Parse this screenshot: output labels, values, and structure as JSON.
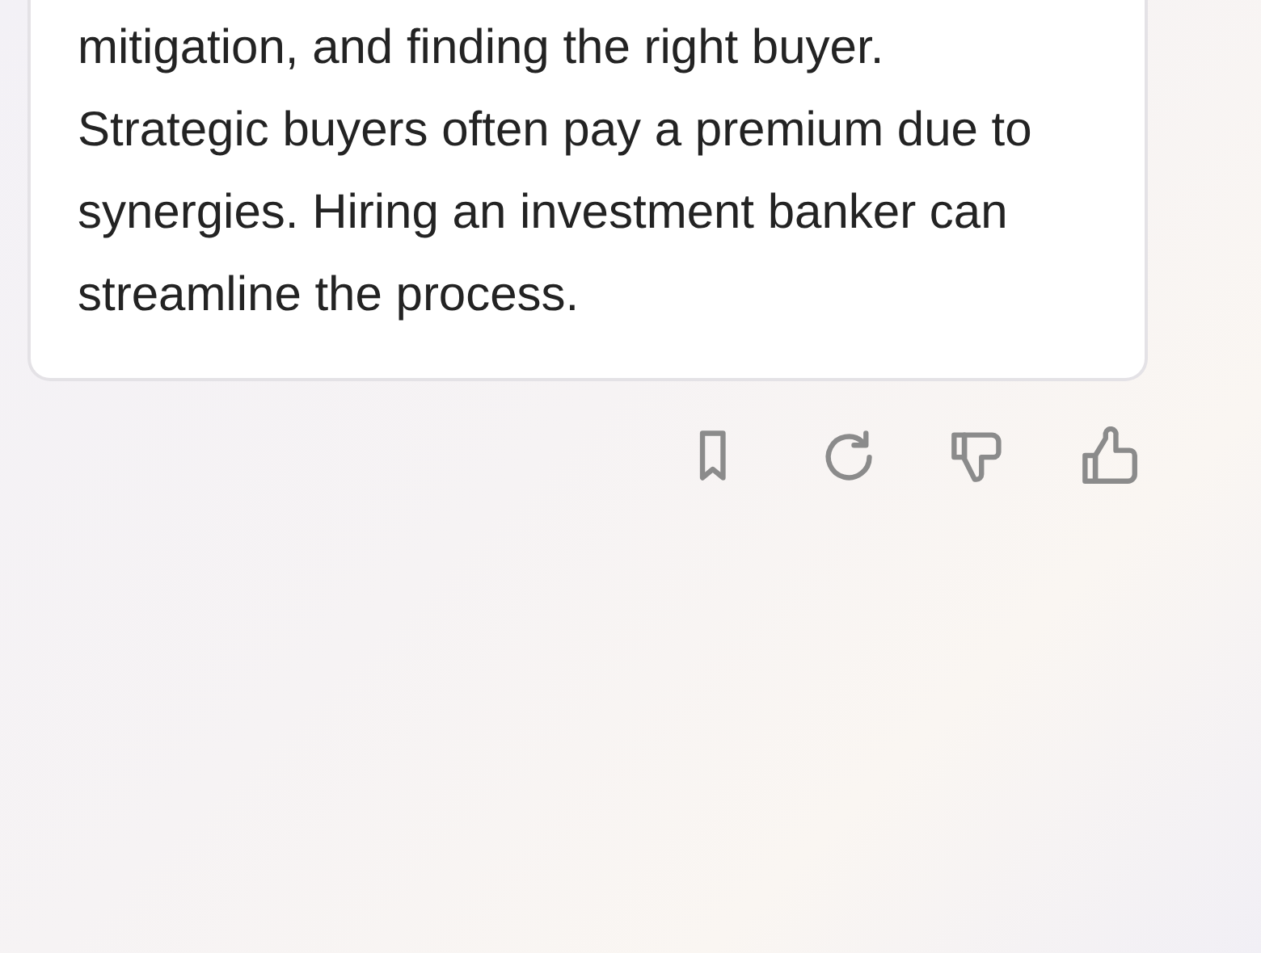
{
  "message": {
    "text": "mitigation, and finding the right buyer. Strategic buyers often pay a premium due to synergies. Hiring an investment banker can streamline the process."
  },
  "actions": [
    {
      "kind": "bookmark"
    },
    {
      "kind": "regenerate"
    },
    {
      "kind": "dislike"
    },
    {
      "kind": "like"
    }
  ]
}
